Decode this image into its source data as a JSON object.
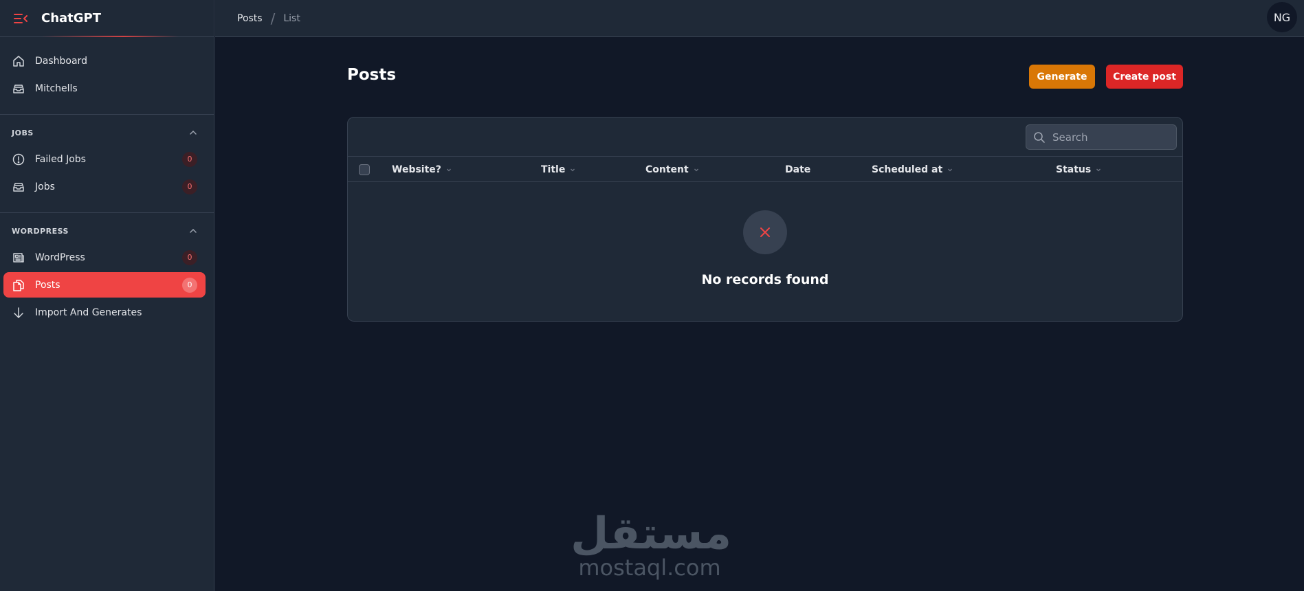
{
  "app": {
    "title": "ChatGPT"
  },
  "sidebar": {
    "top_items": [
      {
        "label": "Dashboard",
        "icon": "home-icon"
      },
      {
        "label": "Mitchells",
        "icon": "inbox-stack-icon"
      }
    ],
    "groups": [
      {
        "label": "JOBS",
        "items": [
          {
            "label": "Failed Jobs",
            "icon": "exclamation-circle-icon",
            "badge": "0"
          },
          {
            "label": "Jobs",
            "icon": "inbox-stack-icon",
            "badge": "0"
          }
        ]
      },
      {
        "label": "WORDPRESS",
        "items": [
          {
            "label": "WordPress",
            "icon": "newspaper-icon",
            "badge": "0"
          },
          {
            "label": "Posts",
            "icon": "document-duplicate-icon",
            "badge": "0",
            "active": true
          },
          {
            "label": "Import And Generates",
            "icon": "arrow-down-icon"
          }
        ]
      }
    ]
  },
  "topbar": {
    "breadcrumb": [
      "Posts",
      "List"
    ],
    "separator": "/",
    "avatar_initials": "NG"
  },
  "main": {
    "title": "Posts",
    "buttons": {
      "generate": "Generate",
      "create": "Create post"
    },
    "search": {
      "placeholder": "Search",
      "value": ""
    },
    "columns": [
      "Website?",
      "Title",
      "Content",
      "Date",
      "Scheduled at",
      "Status"
    ],
    "empty_text": "No records found"
  },
  "watermark": {
    "arabic": "مستقل",
    "latin": "mostaql.com"
  },
  "colors": {
    "accent": "#ef4444",
    "generate": "#d97706",
    "create": "#dc2626",
    "background": "#111827",
    "panel": "#1f2937"
  }
}
